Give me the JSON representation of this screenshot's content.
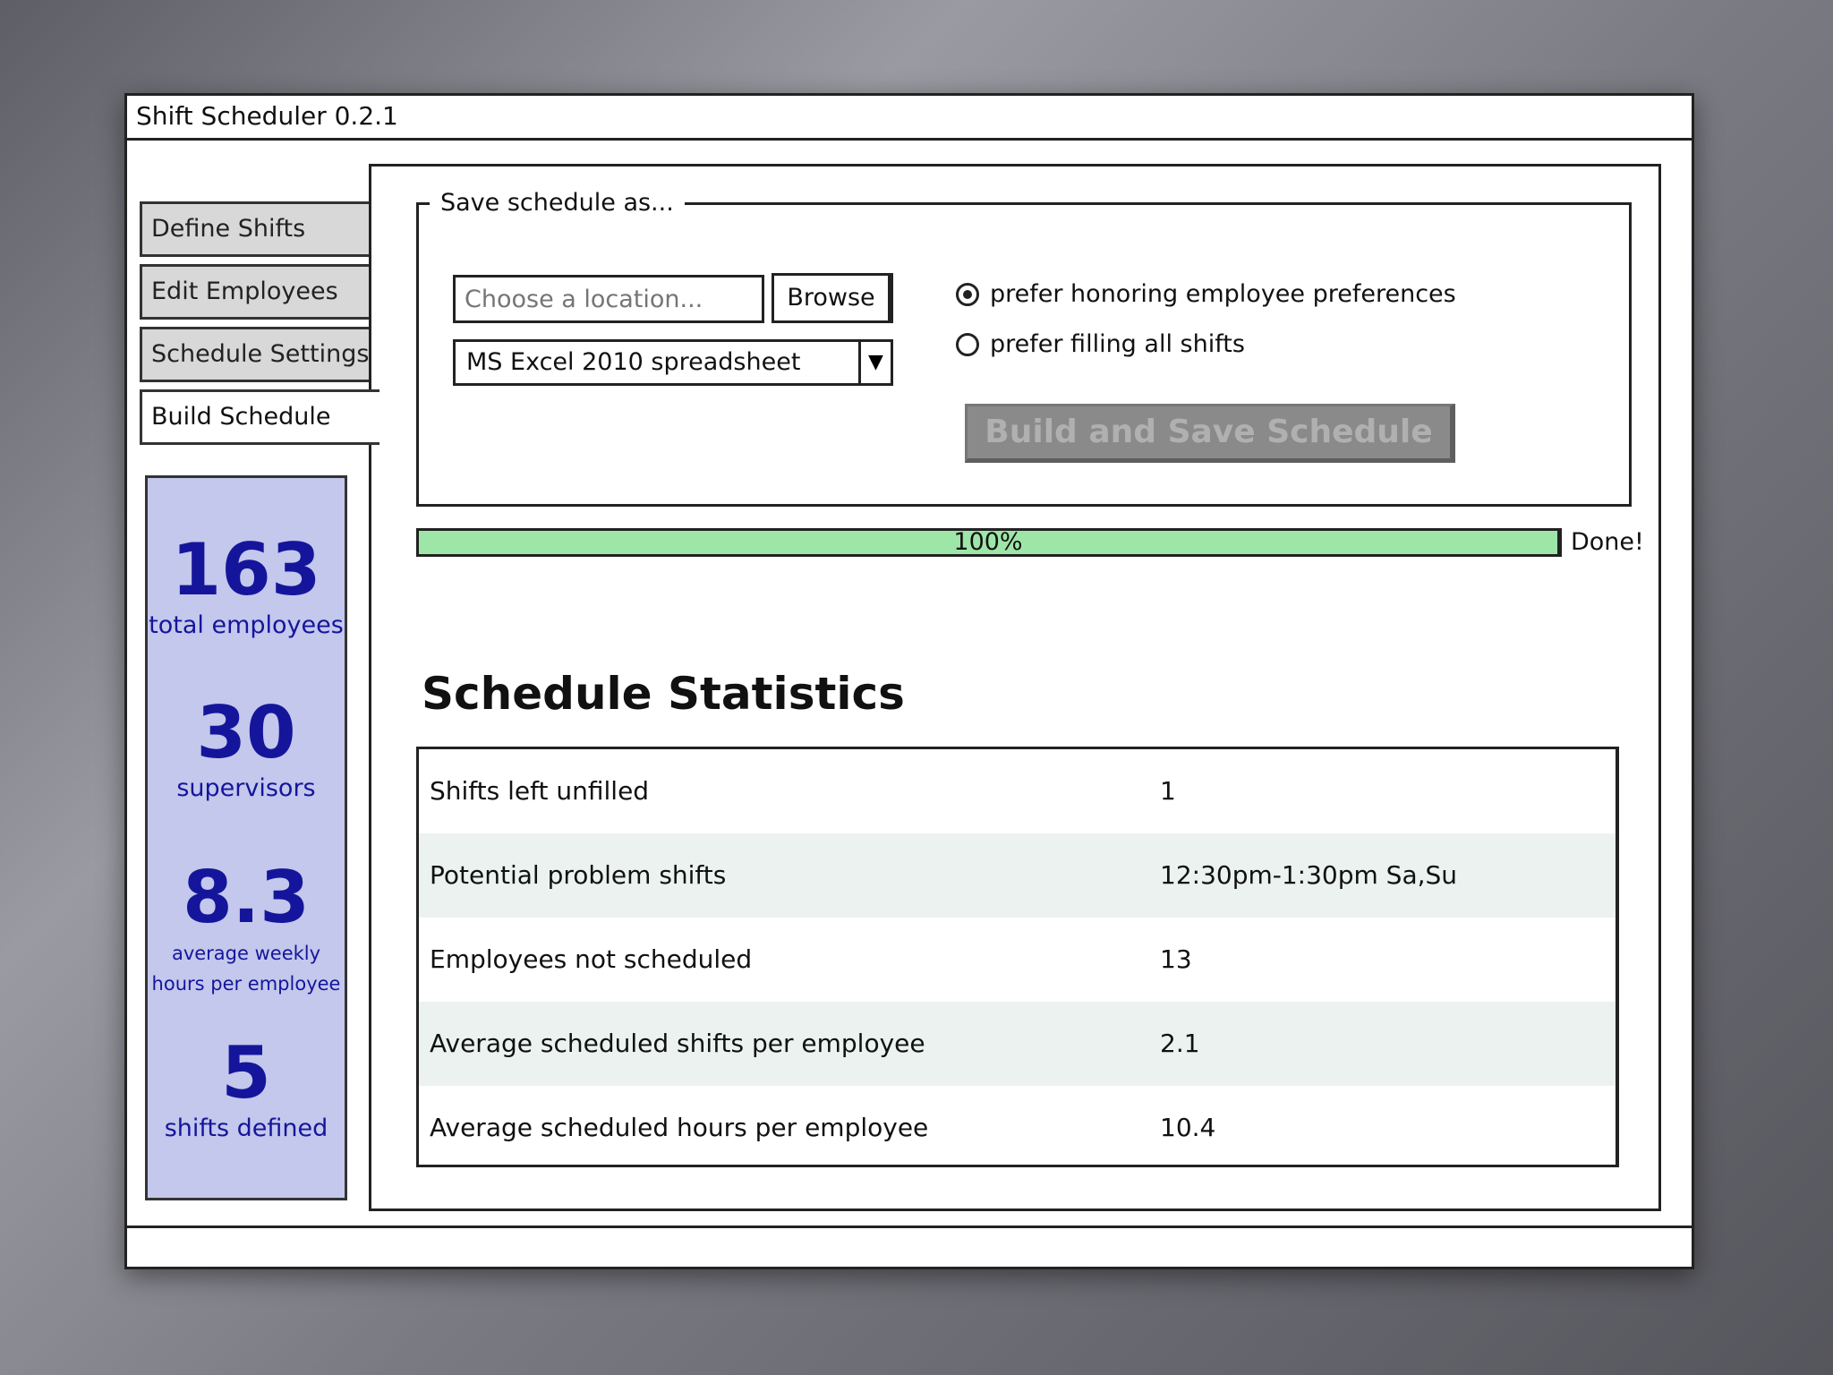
{
  "window": {
    "title": "Shift Scheduler 0.2.1"
  },
  "tabs": [
    {
      "label": "Define Shifts",
      "active": false
    },
    {
      "label": "Edit Employees",
      "active": false
    },
    {
      "label": "Schedule Settings",
      "active": false
    },
    {
      "label": "Build Schedule",
      "active": true
    }
  ],
  "summary": {
    "color": "#15159c",
    "background": "#c3c8ec",
    "total_employees": {
      "value": "163",
      "label": "total employees"
    },
    "supervisors": {
      "value": "30",
      "label": "supervisors"
    },
    "avg_hours": {
      "value": "8.3",
      "label_line1": "average weekly",
      "label_line2": "hours per employee"
    },
    "shifts_defined": {
      "value": "5",
      "label": "shifts defined"
    }
  },
  "save": {
    "legend": "Save schedule as...",
    "location_placeholder": "Choose a location...",
    "browse_label": "Browse",
    "format_selected": "MS Excel 2010 spreadsheet",
    "options": [
      {
        "label": "prefer honoring employee preferences",
        "checked": true
      },
      {
        "label": "prefer filling all shifts",
        "checked": false
      }
    ],
    "build_button_label": "Build and Save Schedule",
    "build_button_enabled": false
  },
  "progress": {
    "value": 1.0,
    "label": "100%",
    "status": "Done!",
    "fill_color": "#9ee6a8"
  },
  "statistics": {
    "title": "Schedule Statistics",
    "rows": [
      {
        "label": "Shifts left unfilled",
        "value": "1"
      },
      {
        "label": "Potential problem shifts",
        "value": "12:30pm-1:30pm Sa,Su"
      },
      {
        "label": "Employees not scheduled",
        "value": "13"
      },
      {
        "label": "Average scheduled shifts per employee",
        "value": "2.1"
      },
      {
        "label": "Average scheduled hours per employee",
        "value": "10.4"
      }
    ]
  }
}
